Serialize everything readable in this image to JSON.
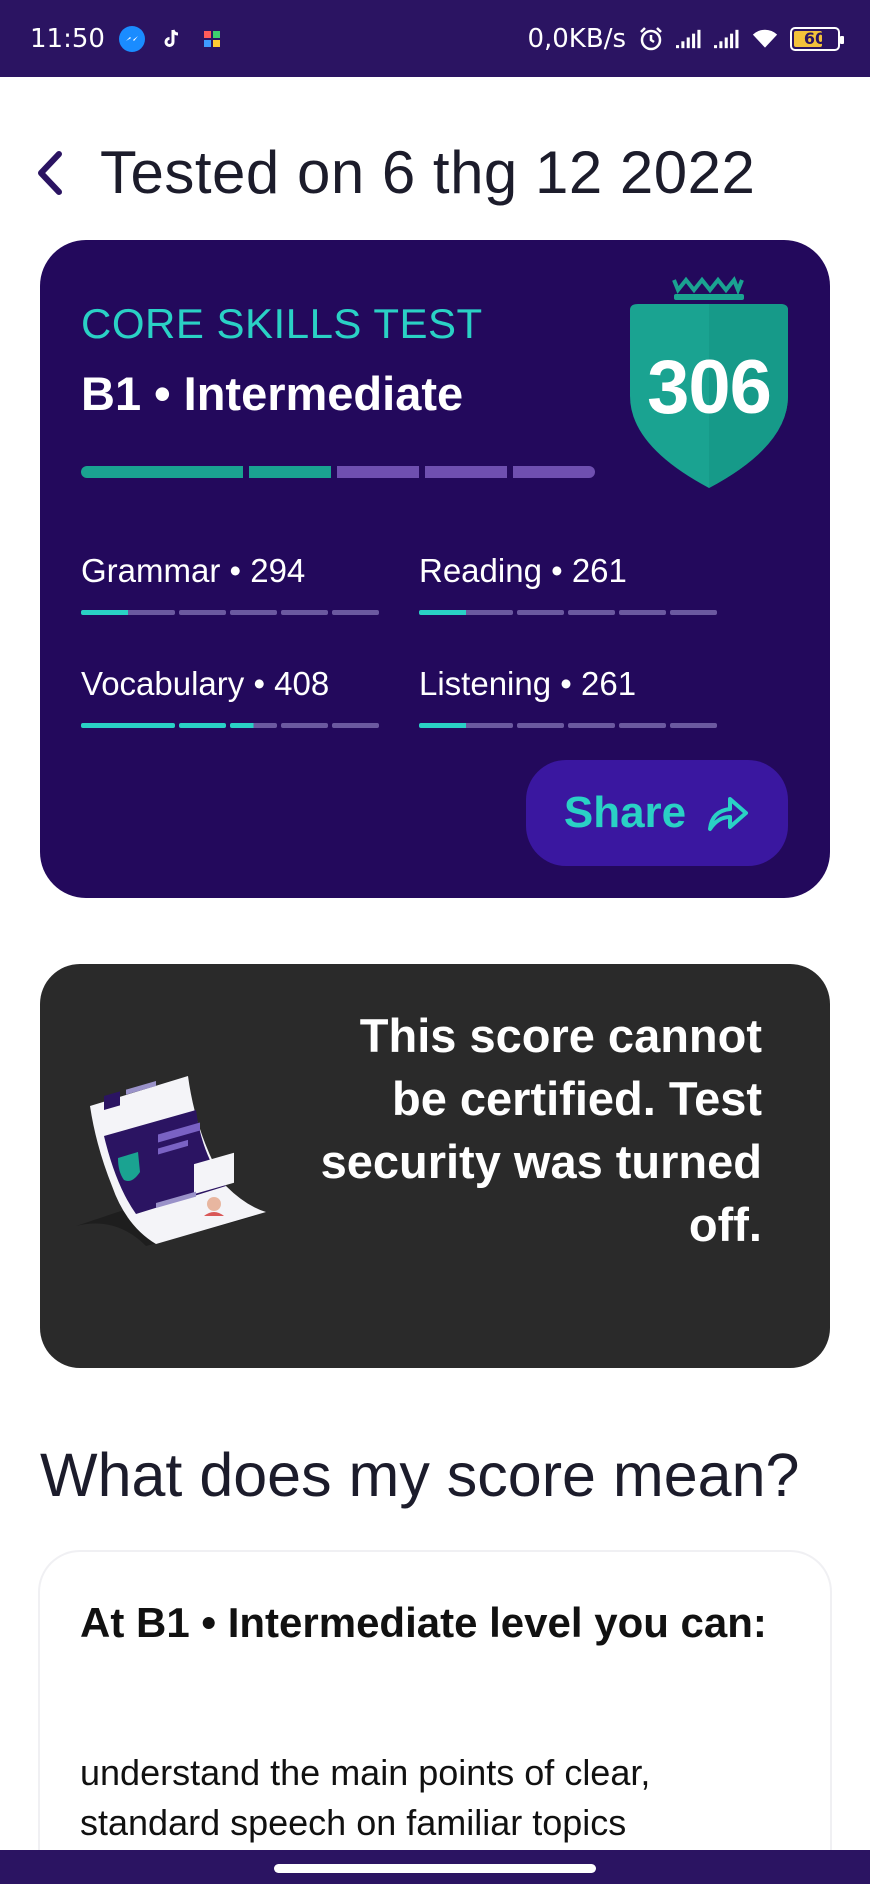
{
  "status_bar": {
    "time": "11:50",
    "net_speed": "0,0KB/s",
    "battery": "60"
  },
  "header": {
    "title": "Tested on 6 thg 12 2022"
  },
  "score_card": {
    "test_name": "CORE SKILLS TEST",
    "level": "B1 • Intermediate",
    "score": "306",
    "level_progress": {
      "filled_segments": 3,
      "total_segments": 6
    },
    "skills": [
      {
        "label": "Grammar • 294",
        "fill_fraction": 0.3
      },
      {
        "label": "Reading • 261",
        "fill_fraction": 0.3
      },
      {
        "label": "Vocabulary • 408",
        "fill_fraction": 0.55
      },
      {
        "label": "Listening • 261",
        "fill_fraction": 0.3
      }
    ],
    "share_label": "Share",
    "colors": {
      "card_bg": "#23095c",
      "accent": "#2ad1c5",
      "shield": "#1aa391"
    }
  },
  "certificate": {
    "message": "This score cannot be certified. Test security was turned off."
  },
  "meaning": {
    "section_title": "What does my score mean?",
    "heading": "At B1 • Intermediate level you can:",
    "body": "understand the main points of clear, standard speech on familiar topics"
  }
}
